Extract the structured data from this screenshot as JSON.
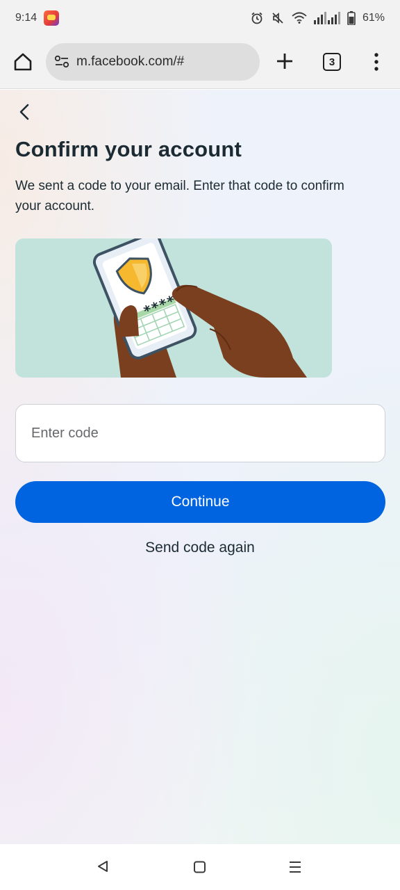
{
  "status_bar": {
    "time": "9:14",
    "battery": "61%",
    "icons": [
      "app-notification-icon",
      "alarm-icon",
      "mute-icon",
      "wifi-icon",
      "signal-icon",
      "battery-icon"
    ]
  },
  "browser": {
    "url": "m.facebook.com/#",
    "tab_count": "3",
    "icons": [
      "home-icon",
      "site-settings-icon",
      "plus-icon",
      "tabs-icon",
      "more-vert-icon"
    ]
  },
  "page": {
    "title": "Confirm your account",
    "subtitle": "We sent a code to your email. Enter that code to confirm your account.",
    "code_input": {
      "placeholder": "Enter code",
      "value": ""
    },
    "continue_label": "Continue",
    "send_again_label": "Send code again",
    "illustration": {
      "masked_code": "****"
    }
  },
  "colors": {
    "primary": "#0064e0",
    "text": "#1c2b33",
    "illustration_bg": "#c2e2dc",
    "shield": "#f5b82e"
  },
  "nav_bar": {
    "icons": [
      "back-triangle-icon",
      "home-square-icon",
      "recents-menu-icon"
    ]
  }
}
